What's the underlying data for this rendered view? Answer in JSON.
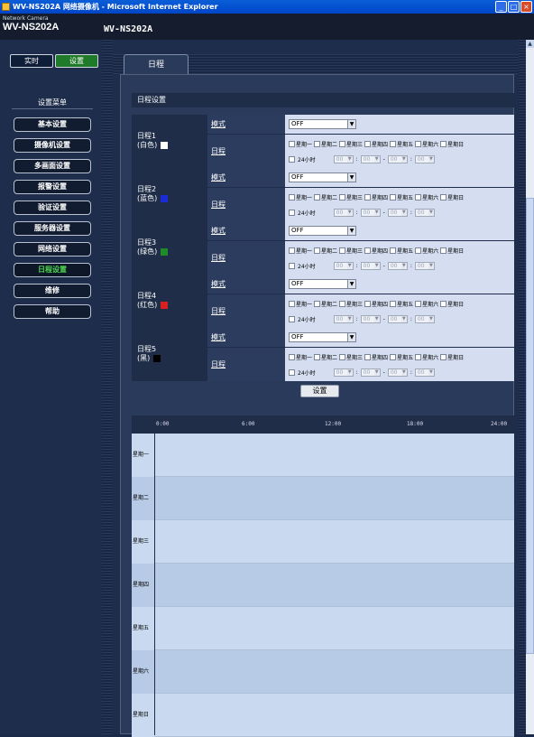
{
  "window": {
    "title": "WV-NS202A 网络摄像机 - Microsoft Internet Explorer",
    "buttons": [
      "_",
      "□",
      "×"
    ]
  },
  "header": {
    "brand_small": "Network Camera",
    "brand_big": "WV-NS202A",
    "model": "WV-NS202A"
  },
  "sidebar": {
    "live_label": "实时",
    "setup_label": "设置",
    "menu_title": "设置菜单",
    "items": [
      {
        "label": "基本设置"
      },
      {
        "label": "摄像机设置"
      },
      {
        "label": "多画面设置"
      },
      {
        "label": "报警设置"
      },
      {
        "label": "验证设置"
      },
      {
        "label": "服务器设置"
      },
      {
        "label": "网络设置"
      },
      {
        "label": "日程设置",
        "current": true
      },
      {
        "label": "维修"
      }
    ],
    "help_label": "帮助"
  },
  "main": {
    "tab_label": "日程",
    "section_title": "日程设置",
    "mode_label": "模式",
    "schedule_label": "日程",
    "schedules": [
      {
        "name": "日程1",
        "color_name": "(白色)",
        "color": "#ffffff",
        "mode": "OFF"
      },
      {
        "name": "日程2",
        "color_name": "(蓝色)",
        "color": "#1a2cd8",
        "mode": "OFF"
      },
      {
        "name": "日程3",
        "color_name": "(绿色)",
        "color": "#1f8a2a",
        "mode": "OFF"
      },
      {
        "name": "日程4",
        "color_name": "(红色)",
        "color": "#d82020",
        "mode": "OFF"
      },
      {
        "name": "日程5",
        "color_name": "(黑)",
        "color": "#000000",
        "mode": "OFF"
      }
    ],
    "days": [
      "星期一",
      "星期二",
      "星期三",
      "星期四",
      "星期五",
      "星期六",
      "星期日"
    ],
    "all_day_label": "24小时",
    "time_values": [
      "00",
      "00",
      "00",
      "00"
    ],
    "time_dash": "-",
    "time_colon": ":",
    "set_button": "设置",
    "timeline_hours": [
      "0:00",
      "6:00",
      "12:00",
      "18:00",
      "24:00"
    ],
    "timeline_days": [
      "星期一",
      "星期二",
      "星期三",
      "星期四",
      "星期五",
      "星期六",
      "星期日"
    ]
  }
}
